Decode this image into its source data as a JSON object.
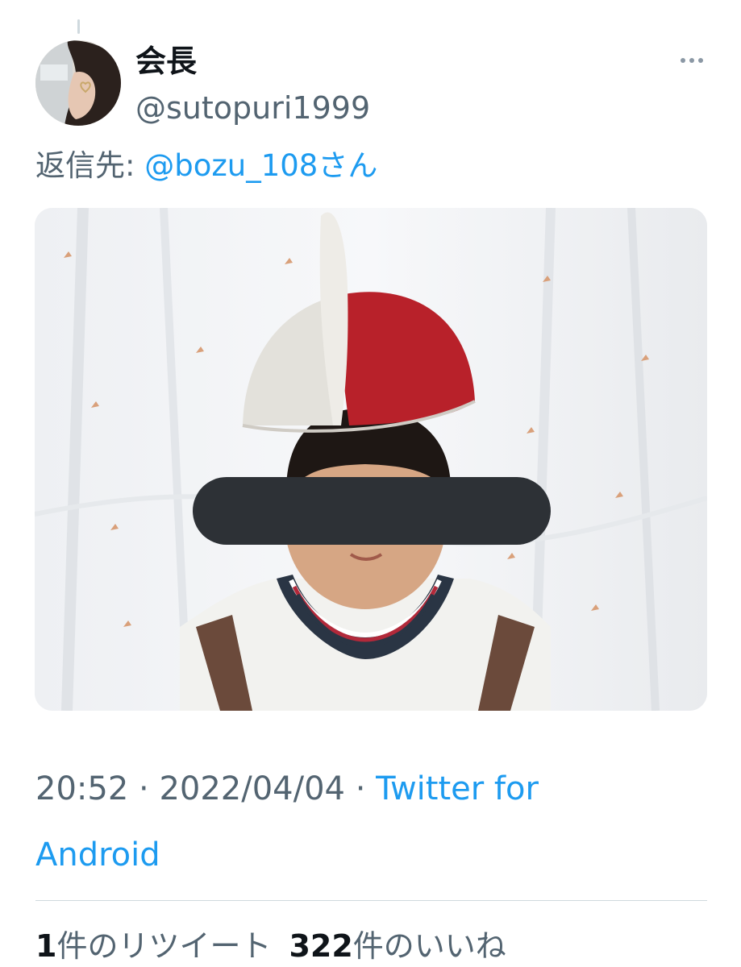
{
  "tweet": {
    "author": {
      "display_name": "会長",
      "handle": "@sutopuri1999"
    },
    "reply_prefix": "返信先: ",
    "reply_to": "@bozu_108さん",
    "time": "20:52",
    "separator": " · ",
    "date": "2022/04/04",
    "source_app": "Twitter for Android",
    "retweets": {
      "count": "1",
      "label": "件のリツイート"
    },
    "likes": {
      "count": "322",
      "label": "件のいいね"
    }
  },
  "icons": {
    "more": "more-horizontal-icon"
  },
  "colors": {
    "text_primary": "#0f1419",
    "text_secondary": "#536471",
    "link": "#1d9bf0",
    "divider": "#cfd9de"
  }
}
